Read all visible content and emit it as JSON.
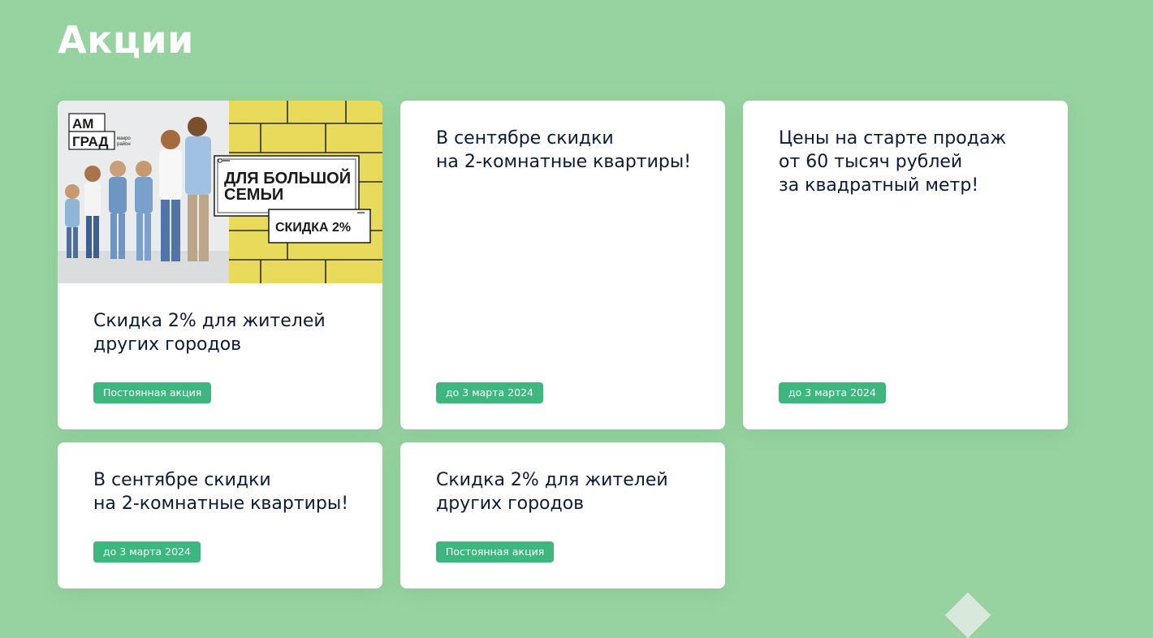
{
  "page": {
    "title": "Акции"
  },
  "cards": [
    {
      "title": "Скидка 2% для жителей\nдругих городов",
      "badge": "Постоянная акция",
      "image": {
        "logo_line1": "АМ",
        "logo_line2": "ГРАД",
        "logo_small_top": "макро",
        "logo_small_bottom": "район",
        "headline_line1": "ДЛЯ БОЛЬШОЙ",
        "headline_line2": "СЕМЬИ",
        "discount": "СКИДКА 2%"
      }
    },
    {
      "title": "В сентябре скидки\nна 2-комнатные квартиры!",
      "badge": "до 3 марта 2024"
    },
    {
      "title": "Цены на старте продаж\nот 60 тысяч рублей\nза квадратный метр!",
      "badge": "до 3 марта 2024"
    },
    {
      "title": "В сентябре скидки\nна 2-комнатные квартиры!",
      "badge": "до 3 марта 2024"
    },
    {
      "title": "Скидка 2% для жителей\nдругих городов",
      "badge": "Постоянная акция"
    }
  ],
  "colors": {
    "background": "#96d3a0",
    "card": "#ffffff",
    "badge": "#3db77e",
    "title_text": "#0c1b3a",
    "image_yellow": "#e8db5c"
  }
}
